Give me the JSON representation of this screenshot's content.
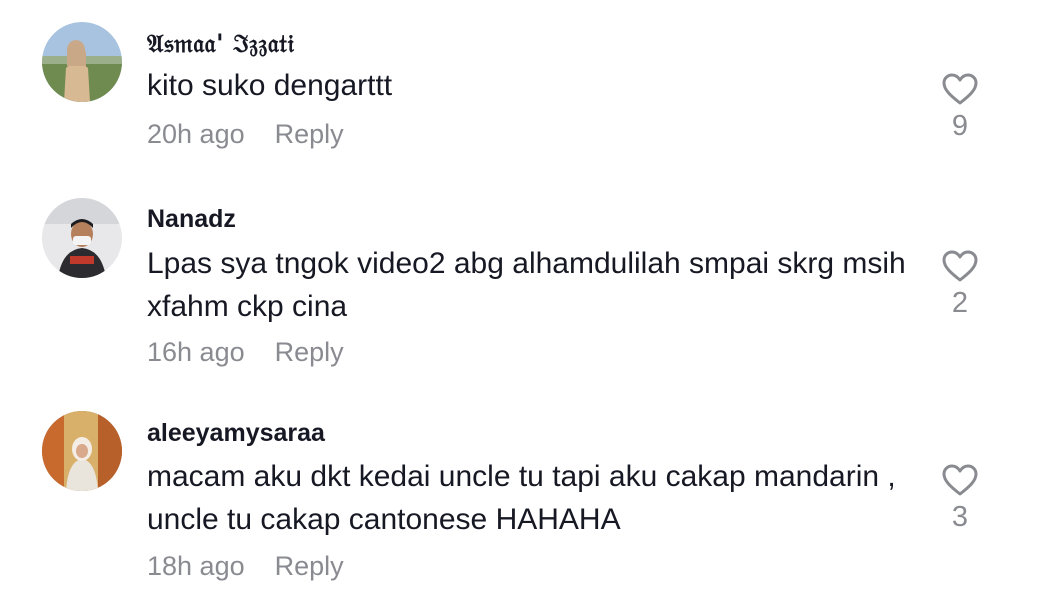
{
  "comments": [
    {
      "username": "𝔄𝔰𝔪𝔞𝔞' ℑ𝔷𝔷𝔞𝔱𝔦",
      "text": "kito suko dengarttt",
      "time": "20h ago",
      "reply_label": "Reply",
      "likes": "9"
    },
    {
      "username": "Nanadz",
      "text": "Lpas sya tngok video2 abg alhamdulilah smpai skrg msih xfahm ckp cina",
      "time": "16h ago",
      "reply_label": "Reply",
      "likes": "2"
    },
    {
      "username": "aleeyamysaraa",
      "text": "macam aku dkt kedai uncle tu tapi aku cakap mandarin , uncle tu cakap cantonese HAHAHA",
      "time": "18h ago",
      "reply_label": "Reply",
      "likes": "3"
    }
  ],
  "icons": {
    "like": "heart-outline-icon"
  },
  "colors": {
    "text": "#161823",
    "muted": "#8a8b91",
    "background": "#ffffff"
  }
}
